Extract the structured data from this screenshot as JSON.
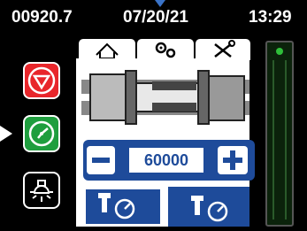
{
  "status_bar": {
    "counter": "00920.7",
    "date": "07/20/21",
    "time": "13:29"
  },
  "sidebar": {
    "items": [
      {
        "name": "stop",
        "icon": "stop-hexagon-icon",
        "color": "#e8262b"
      },
      {
        "name": "timer",
        "icon": "stopwatch-icon",
        "color": "#1f9e3e",
        "selected": true
      },
      {
        "name": "light",
        "icon": "lamp-icon",
        "color": "#000000"
      }
    ]
  },
  "tabs": [
    {
      "icon": "home-icon",
      "active": true
    },
    {
      "icon": "gears-icon",
      "active": false
    },
    {
      "icon": "tools-icon",
      "active": false
    }
  ],
  "stepper": {
    "value": "60000",
    "minus_icon": "minus-icon",
    "plus_icon": "plus-icon"
  },
  "mode_buttons": [
    {
      "icon": "sensor-gauge-icon",
      "active": true
    },
    {
      "icon": "sensor-gauge-icon",
      "active": false
    }
  ],
  "gauge": {
    "indicator_color": "#2fbf3a"
  },
  "colors": {
    "accent_blue": "#1e4b9a",
    "highlight_green": "#2fbf3a"
  }
}
